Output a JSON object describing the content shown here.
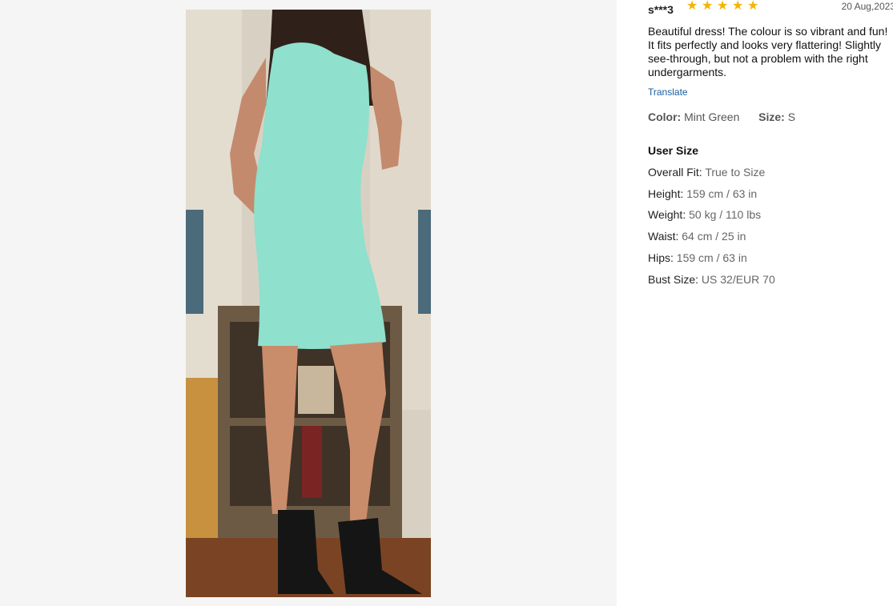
{
  "review": {
    "reviewer": "s***3",
    "rating": 5,
    "date": "20 Aug,2023",
    "text": "Beautiful dress! The colour is so vibrant and fun! It fits perfectly and looks very flattering! Slightly see-through, but not a problem with the right undergarments.",
    "translate_label": "Translate",
    "color_label": "Color:",
    "color_value": "Mint Green",
    "size_label": "Size:",
    "size_value": "S"
  },
  "user_size": {
    "title": "User Size",
    "rows": [
      {
        "label": "Overall Fit:",
        "value": "True to Size"
      },
      {
        "label": "Height:",
        "value": "159 cm / 63 in"
      },
      {
        "label": "Weight:",
        "value": "50 kg / 110 lbs"
      },
      {
        "label": "Waist:",
        "value": "64 cm / 25 in"
      },
      {
        "label": "Hips:",
        "value": "159 cm / 63 in"
      },
      {
        "label": "Bust Size:",
        "value": "US 32/EUR 70"
      }
    ]
  },
  "colors": {
    "star": "#f5b400",
    "link": "#1a5fa0",
    "panel_bg": "#f5f5f5",
    "dress": "#8fe0cc"
  },
  "icons": {
    "star": "star-icon"
  }
}
